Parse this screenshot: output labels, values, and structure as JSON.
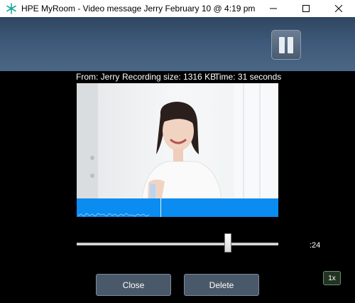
{
  "window": {
    "title": "HPE MyRoom - Video message Jerry February 10 @ 4:19 pm",
    "app_icon": "snowflake-app-icon"
  },
  "header": {
    "pause_icon": "pause-icon"
  },
  "info": {
    "from": "From: Jerry",
    "recording_size": "Recording size: 1316 KB",
    "time": "Time: 31 seconds"
  },
  "player": {
    "position_fraction": 0.75,
    "time_remaining": ":24",
    "speed": "1x"
  },
  "buttons": {
    "close": "Close",
    "delete": "Delete"
  },
  "colors": {
    "header_gradient": "#3d5878",
    "waveform": "#0a8cf0",
    "button_bg": "#4a596a",
    "speed_button_bg": "#213421"
  }
}
